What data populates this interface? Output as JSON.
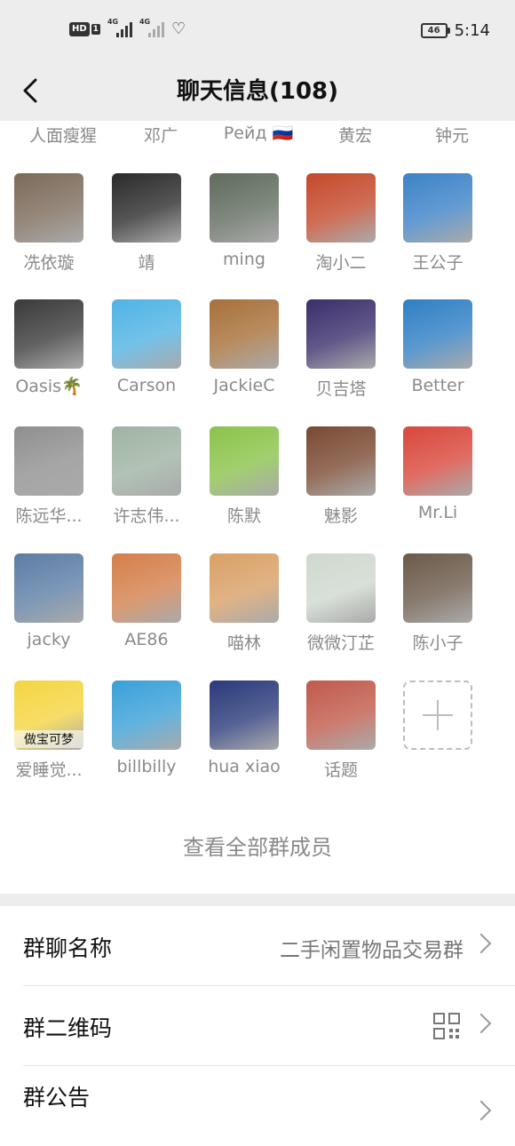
{
  "status_bar": {
    "hd_label": "HD",
    "hd_sub": "1",
    "signal1_label": "4G",
    "signal2_label": "4G",
    "battery": "46",
    "time": "5:14"
  },
  "header": {
    "title": "聊天信息(108)"
  },
  "partial_members": [
    "人面瘦猩",
    "邓广",
    "Рейд 🇷🇺",
    "黄宏",
    "钟元"
  ],
  "members": [
    {
      "name": "冼依璇",
      "color": "#7b6a5a"
    },
    {
      "name": "靖",
      "color": "#2b2b2b"
    },
    {
      "name": "ming",
      "color": "#5f6b5d"
    },
    {
      "name": "淘小二",
      "color": "#c4492b"
    },
    {
      "name": "王公子",
      "color": "#3c82c7"
    },
    {
      "name": "Oasis🌴",
      "color": "#3a3a3a"
    },
    {
      "name": "Carson",
      "color": "#4fb3e4"
    },
    {
      "name": "JackieC",
      "color": "#a7703a"
    },
    {
      "name": "贝吉塔",
      "color": "#3b2e6b"
    },
    {
      "name": "Better",
      "color": "#2f7fc4"
    },
    {
      "name": "陈远华...",
      "color": "#8f8f8f"
    },
    {
      "name": "许志伟...",
      "color": "#9fb3a3"
    },
    {
      "name": "陈默",
      "color": "#8bc34a"
    },
    {
      "name": "魅影",
      "color": "#7a4a32"
    },
    {
      "name": "Mr.Li",
      "color": "#d9473b"
    },
    {
      "name": "jacky",
      "color": "#5c7da5"
    },
    {
      "name": "AE86",
      "color": "#d47f4a"
    },
    {
      "name": "喵林",
      "color": "#d9a066"
    },
    {
      "name": "微微汀芷",
      "color": "#cfd8cf"
    },
    {
      "name": "陈小子",
      "color": "#6b5a4a"
    },
    {
      "name": "爱睡觉...",
      "color": "#f5d542",
      "overlay": "做宝可梦"
    },
    {
      "name": "billbilly",
      "color": "#3aa0d8"
    },
    {
      "name": "hua xiao",
      "color": "#2a3a7a"
    },
    {
      "name": "话题",
      "color": "#c05a4a"
    }
  ],
  "view_all_label": "查看全部群成员",
  "settings": {
    "group_name_label": "群聊名称",
    "group_name_value": "二手闲置物品交易群",
    "qr_label": "群二维码",
    "notice_label": "群公告"
  }
}
